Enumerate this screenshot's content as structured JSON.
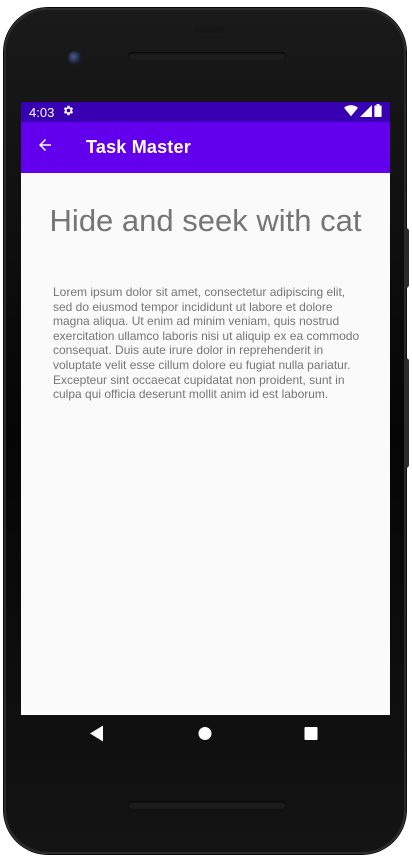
{
  "status_bar": {
    "time": "4:03",
    "icons": [
      "settings-icon",
      "wifi-icon",
      "signal-icon",
      "battery-icon"
    ],
    "background": "#3700b3"
  },
  "app_bar": {
    "title": "Task Master",
    "back_icon": "arrow-back-icon",
    "background": "#6200ee"
  },
  "task": {
    "title": "Hide and seek with cat",
    "body": "Lorem ipsum dolor sit amet, consectetur adipiscing elit, sed do eiusmod tempor incididunt ut labore et dolore magna aliqua. Ut enim ad minim veniam, quis nostrud exercitation ullamco laboris nisi ut aliquip ex ea commodo consequat. Duis aute irure dolor in reprehenderit in voluptate velit esse cillum dolore eu fugiat nulla pariatur. Excepteur sint occaecat cupidatat non proident, sunt in culpa qui officia deserunt mollit anim id est laborum."
  },
  "nav_bar": {
    "icons": [
      "back-triangle-icon",
      "home-circle-icon",
      "recents-square-icon"
    ]
  }
}
